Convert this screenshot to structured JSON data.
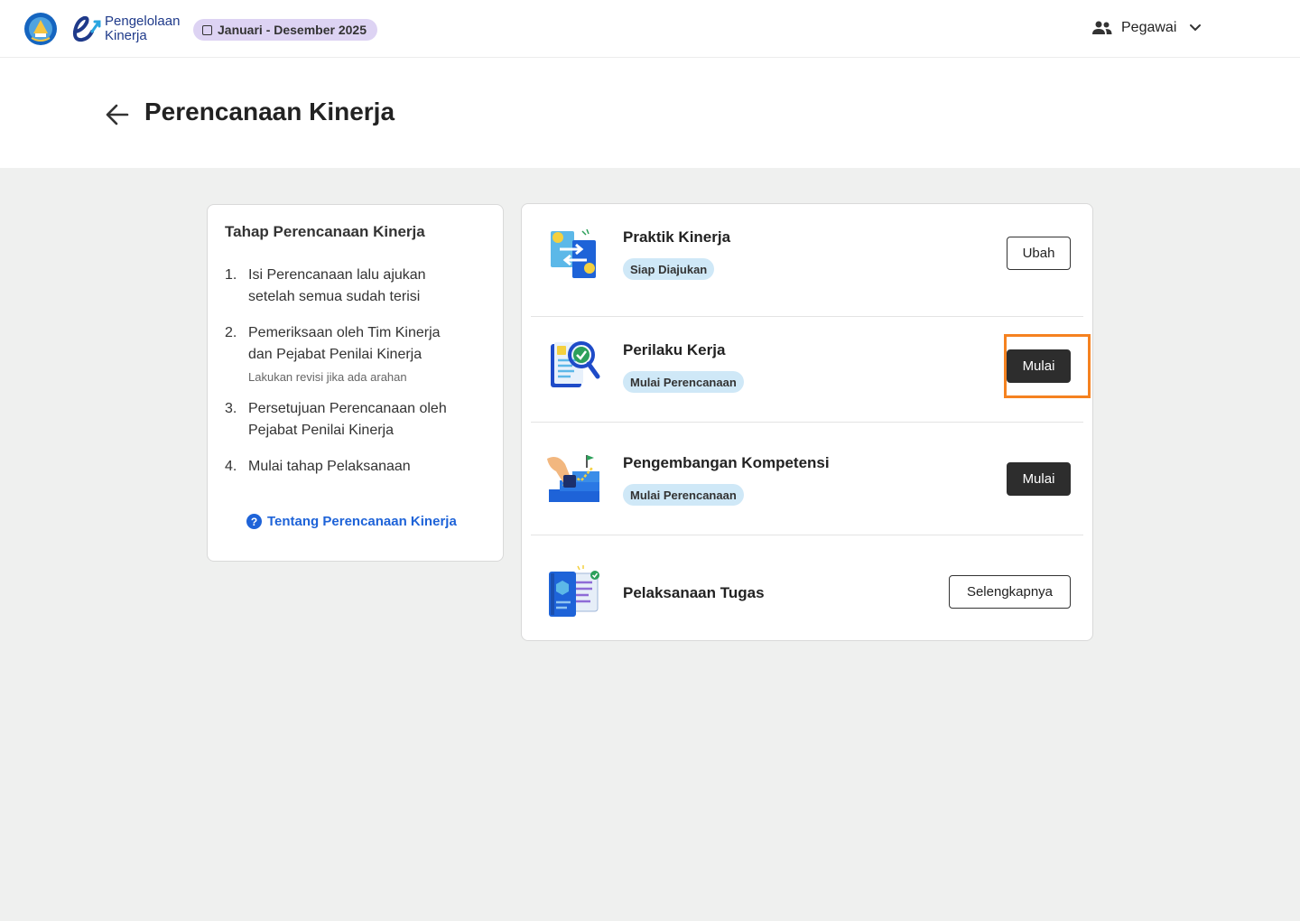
{
  "header": {
    "app_name_line1": "Pengelolaan",
    "app_name_line2": "Kinerja",
    "period": "Januari - Desember 2025",
    "role": "Pegawai"
  },
  "page": {
    "title": "Perencanaan Kinerja"
  },
  "steps_card": {
    "title": "Tahap Perencanaan Kinerja",
    "steps": [
      {
        "num": "1.",
        "text": "Isi Perencanaan lalu ajukan setelah semua sudah terisi",
        "note": ""
      },
      {
        "num": "2.",
        "text": "Pemeriksaan oleh Tim Kinerja dan Pejabat Penilai Kinerja",
        "note": "Lakukan revisi jika ada arahan"
      },
      {
        "num": "3.",
        "text": "Persetujuan Perencanaan oleh Pejabat Penilai Kinerja",
        "note": ""
      },
      {
        "num": "4.",
        "text": "Mulai tahap Pelaksanaan",
        "note": ""
      }
    ],
    "about_link": "Tentang Perencanaan Kinerja"
  },
  "tasks": [
    {
      "name": "Praktik Kinerja",
      "badge": "Siap Diajukan",
      "button": "Ubah"
    },
    {
      "name": "Perilaku Kerja",
      "badge": "Mulai Perencanaan",
      "button": "Mulai"
    },
    {
      "name": "Pengembangan Kompetensi",
      "badge": "Mulai Perencanaan",
      "button": "Mulai"
    },
    {
      "name": "Pelaksanaan Tugas",
      "badge": "",
      "button": "Selengkapnya"
    }
  ],
  "colors": {
    "accent_blue": "#1e63d8",
    "badge_bg": "#cfe8f7",
    "period_chip_bg": "#ddd3f3",
    "highlight": "#f58220",
    "dark_button": "#2d2d2d"
  }
}
